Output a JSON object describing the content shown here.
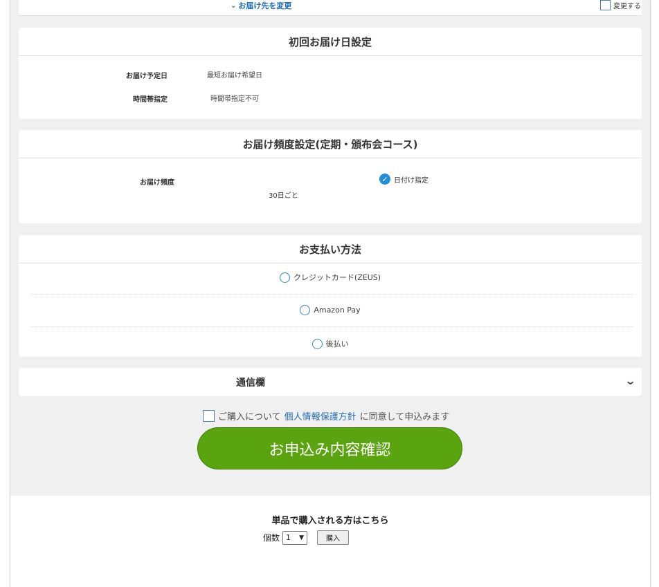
{
  "top": {
    "change_destination": "お届け先を変更",
    "change_checkbox_label": "変更する"
  },
  "first_delivery": {
    "title": "初回お届け日設定",
    "rows": [
      {
        "label": "お届け予定日",
        "value": "最短お届け希望日"
      },
      {
        "label": "時間帯指定",
        "value": "時間帯指定不可"
      }
    ]
  },
  "frequency": {
    "title": "お届け頻度設定(定期・頒布会コース)",
    "label": "お届け頻度",
    "option_label": "日付け指定",
    "value": "30日ごと"
  },
  "payment": {
    "title": "お支払い方法",
    "options": [
      "クレジットカード(ZEUS)",
      "Amazon Pay",
      "後払い"
    ]
  },
  "message": {
    "title": "通信欄"
  },
  "agreement": {
    "prefix": "ご購入について",
    "link": "個人情報保護方針",
    "suffix": "に同意して申込みます"
  },
  "confirm_button": "お申込み内容確認",
  "single": {
    "heading": "単品で購入される方はこちら",
    "qty_label": "個数",
    "qty_value": "1",
    "buy_label": "購入"
  },
  "colors": {
    "accent_blue": "#1f6fb5",
    "confirm_green": "#5aa50f",
    "page_bg": "#f0f0f0"
  }
}
